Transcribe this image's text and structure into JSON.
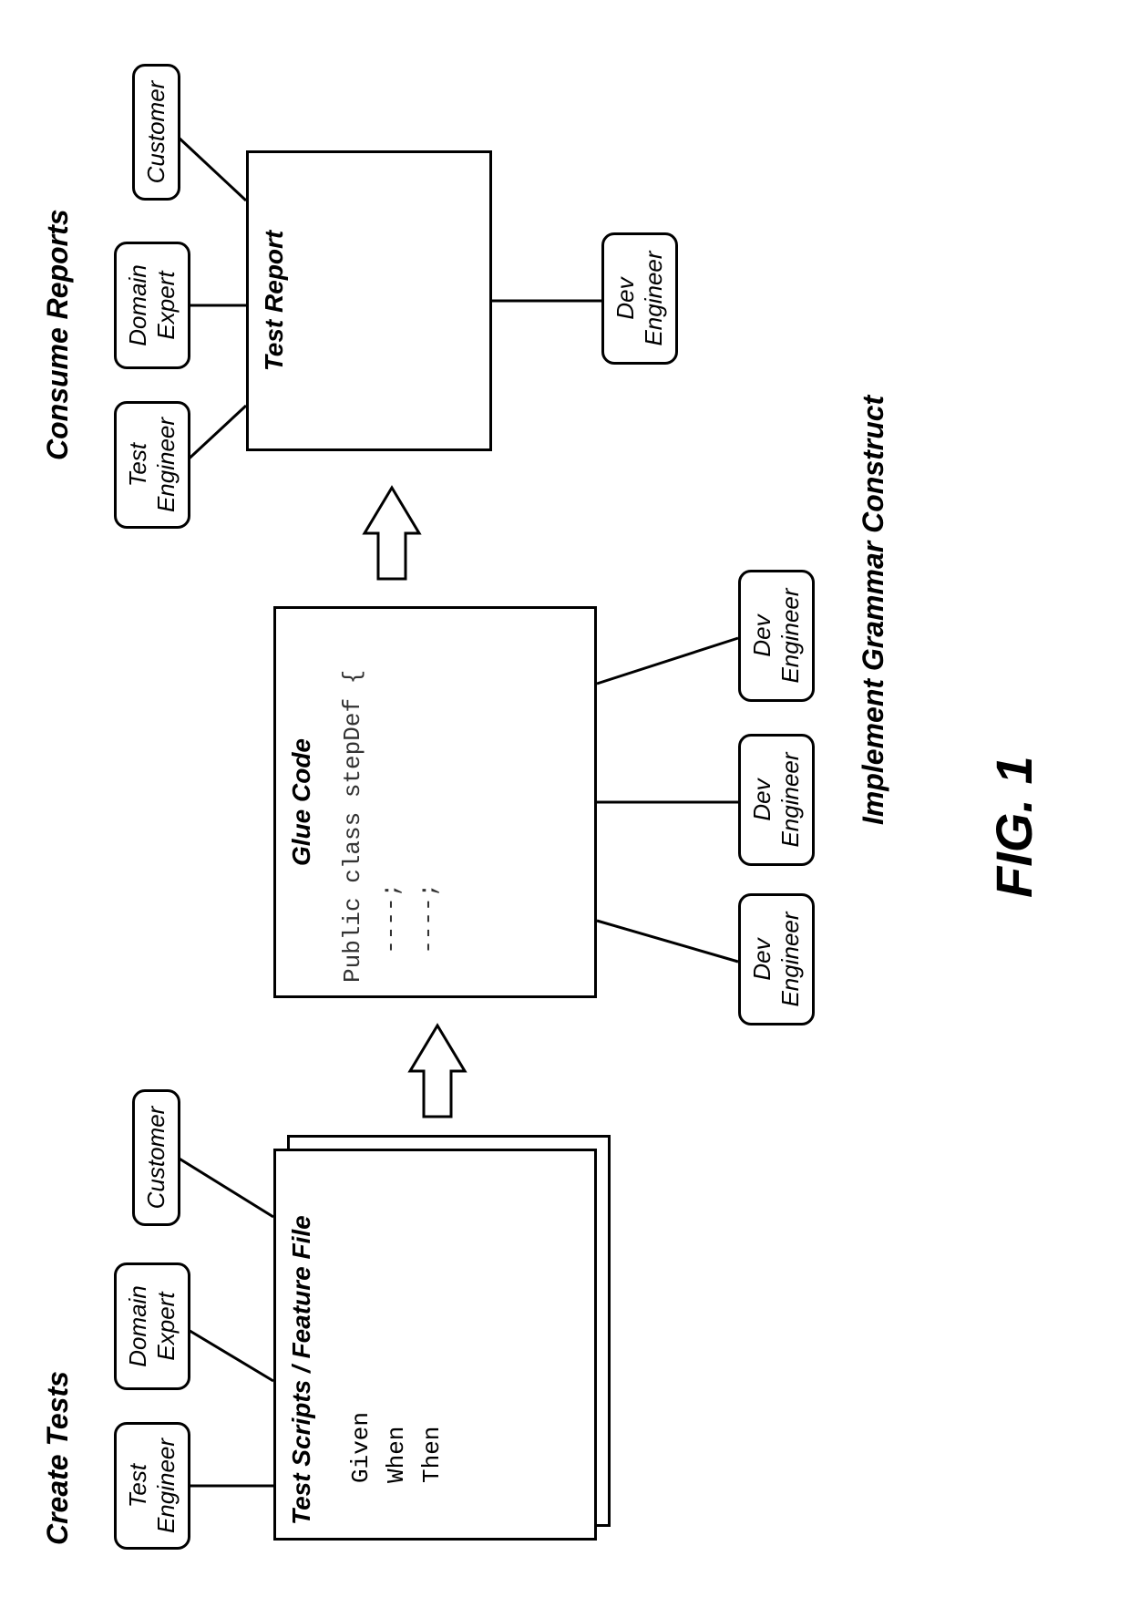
{
  "sections": {
    "create_tests": "Create Tests",
    "consume_reports": "Consume Reports",
    "implement_grammar": "Implement Grammar Construct"
  },
  "actors": {
    "test_engineer": "Test\nEngineer",
    "domain_expert": "Domain\nExpert",
    "customer": "Customer",
    "dev_engineer": "Dev\nEngineer"
  },
  "boxes": {
    "feature_file": {
      "title": "Test Scripts / Feature File",
      "code": "Given\nWhen\nThen"
    },
    "glue_code": {
      "title": "Glue Code",
      "code": "Public class stepDef {\n  ----;\n  ----;"
    },
    "test_report": {
      "title": "Test Report"
    }
  },
  "figure_label": "FIG. 1"
}
